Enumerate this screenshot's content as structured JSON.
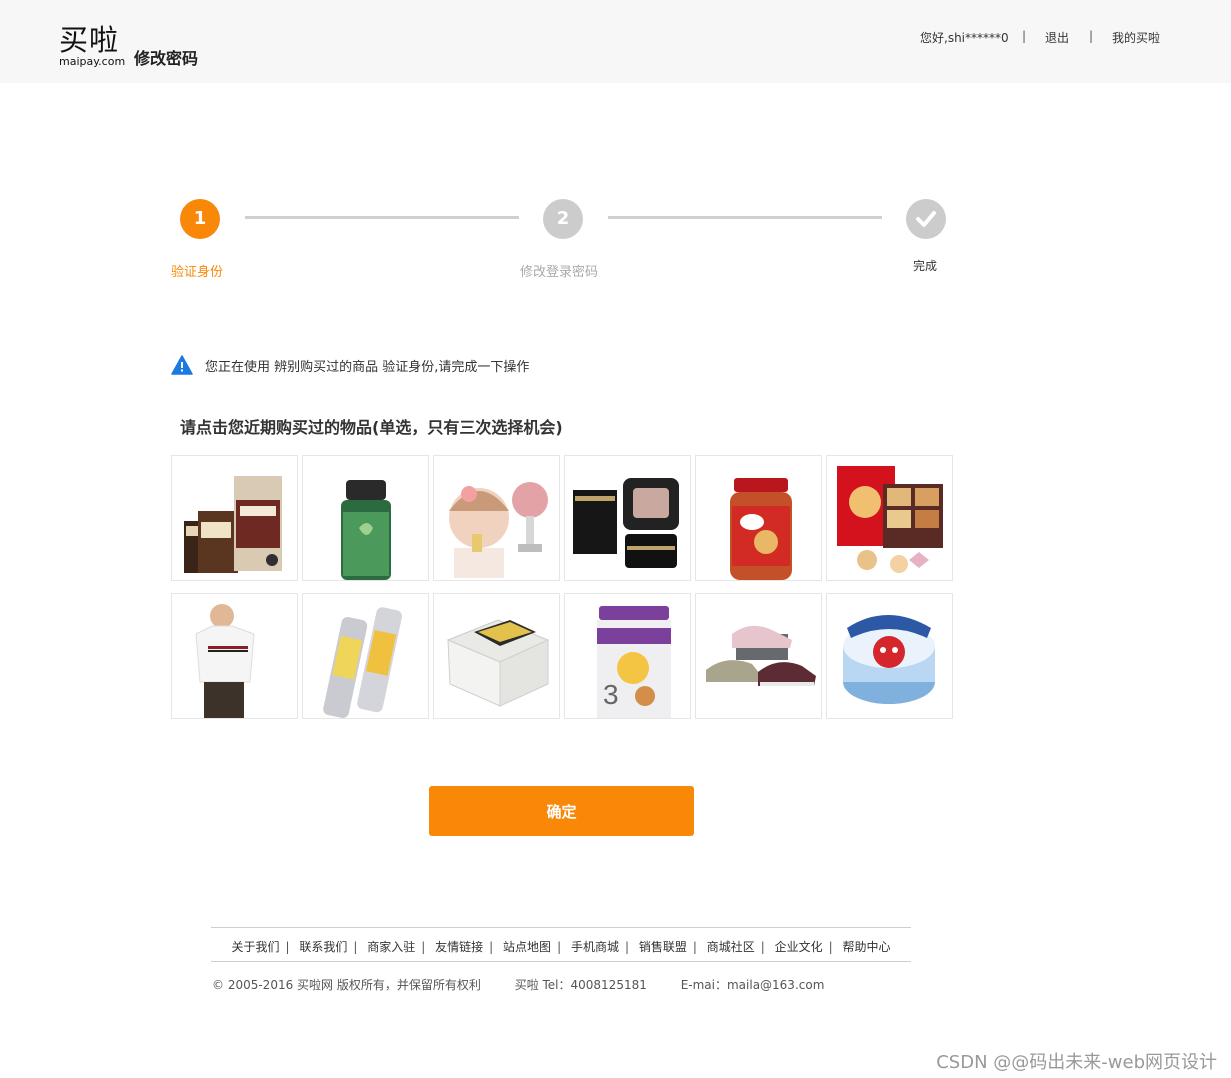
{
  "header": {
    "logo_text": "买啦",
    "logo_sub": "maipay.com",
    "page_title": "修改密码",
    "greeting": "您好,shi******0",
    "logout": "退出",
    "my_account": "我的买啦",
    "separator": "|"
  },
  "steps": [
    {
      "number": "1",
      "label": "验证身份",
      "state": "active",
      "color": "#f98809"
    },
    {
      "number": "2",
      "label": "修改登录密码",
      "state": "pending",
      "color": "#cccccc"
    },
    {
      "number": "",
      "label": "完成",
      "state": "pending",
      "icon": "checkmark-icon",
      "color": "#cccccc"
    }
  ],
  "notice": {
    "icon": "warning-icon",
    "text": "您正在使用 辨别购买过的商品 验证身份,请完成一下操作"
  },
  "question": "请点击您近期购买过的物品(单选，只有三次选择机会)",
  "products": [
    {
      "name": "drip-bag-coffee"
    },
    {
      "name": "supplement-bottle"
    },
    {
      "name": "baby-feeder"
    },
    {
      "name": "givenchy-compact"
    },
    {
      "name": "kraft-peanut-butter"
    },
    {
      "name": "cookie-tin"
    },
    {
      "name": "white-tshirt"
    },
    {
      "name": "sunscreen-spray"
    },
    {
      "name": "food-container"
    },
    {
      "name": "a2-platinum-formula"
    },
    {
      "name": "sneakers"
    },
    {
      "name": "la-vache-qui-rit-cheese"
    }
  ],
  "confirm_label": "确定",
  "footer": {
    "links": [
      "关于我们",
      "联系我们",
      "商家入驻",
      "友情链接",
      "站点地图",
      "手机商城",
      "销售联盟",
      "商城社区",
      "企业文化",
      "帮助中心"
    ],
    "copyright": "©  2005-2016 买啦网 版权所有，并保留所有权利",
    "tel": "买啦 Tel：4008125181",
    "email": "E-mai：maila@163.com"
  },
  "watermark": "CSDN @@码出未来-web网页设计",
  "colors": {
    "accent": "#f98809",
    "inactive": "#cccccc",
    "notice_icon": "#1a7ae0"
  }
}
